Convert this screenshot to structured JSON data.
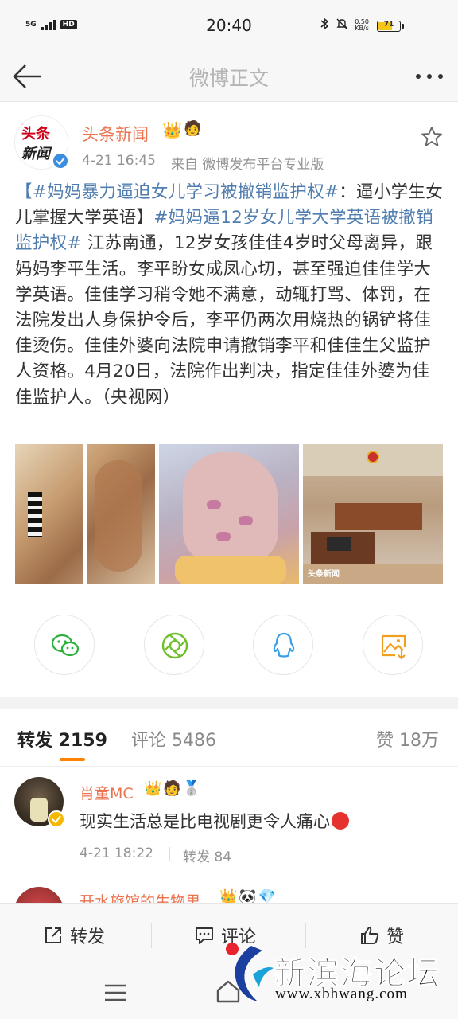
{
  "status_bar": {
    "network": "5G",
    "hd": "HD",
    "time": "20:40",
    "speed_top": "0.50",
    "speed_bottom": "KB/s",
    "battery": "71",
    "battery_level": 0.71
  },
  "header": {
    "title": "微博正文"
  },
  "post": {
    "author": "头条新闻",
    "avatar_line1": "头条",
    "avatar_line2": "新闻",
    "time": "4-21 16:45",
    "source": "来自 微博发布平台专业版",
    "text_parts": [
      "【#妈妈暴力逼迫女儿学习被撤销监护权#",
      "：逼小学生女儿掌握大学英语】",
      "#妈妈逼12岁女儿学大学英语被撤销监护权#",
      " 江苏南通，12岁女孩佳佳4岁时父母离异，跟妈妈李平生活。李平盼女成凤心切，甚至强迫佳佳学大学英语。佳佳学习稍令她不满意，动辄打骂、体罚，在法院发出人身保护令后，李平仍两次用烧热的锅铲将佳佳烫伤。佳佳外婆向法院申请撤销李平和佳佳生父监护人资格。4月20日，法院作出判决，指定佳佳外婆为佳佳监护人。（央视网）"
    ],
    "photo_watermark": "头条新闻"
  },
  "share": {
    "icons": [
      "wechat-icon",
      "moments-icon",
      "qq-icon",
      "save-image-icon"
    ]
  },
  "tabs": {
    "repost": "转发 2159",
    "comment": "评论 5486",
    "like": "赞 18万"
  },
  "comments": [
    {
      "name": "肖童MC",
      "text": "现实生活总是比电视剧更令人痛心",
      "time": "4-21 18:22",
      "repost": "转发 84"
    },
    {
      "name": "开水旅馆的生物里"
    }
  ],
  "bottom_actions": {
    "repost": "转发",
    "comment": "评论",
    "like": "赞"
  },
  "watermark": {
    "title": "新滨海论坛",
    "url": "www.xbhwang.com"
  },
  "colors": {
    "accent_orange": "#ff8200",
    "name_orange": "#eb7350",
    "topic_blue": "#507daf",
    "muted_gray": "#939393"
  }
}
